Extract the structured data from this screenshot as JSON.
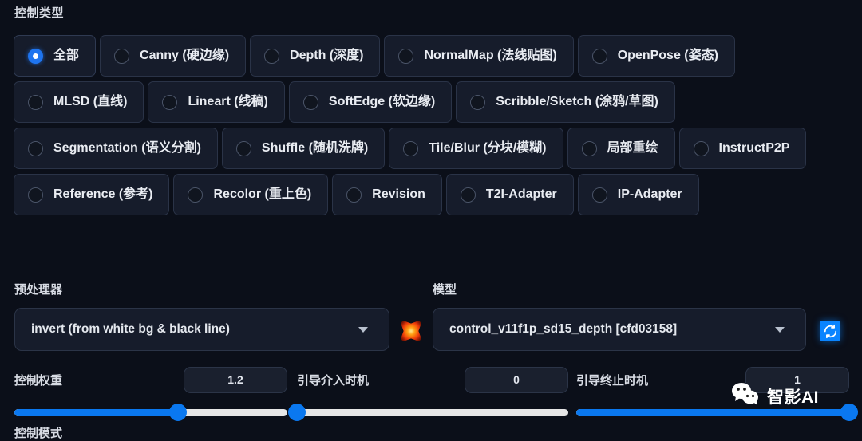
{
  "section": {
    "control_type_label": "控制类型"
  },
  "control_types": [
    {
      "label": "全部",
      "selected": true
    },
    {
      "label": "Canny (硬边缘)",
      "selected": false
    },
    {
      "label": "Depth (深度)",
      "selected": false
    },
    {
      "label": "NormalMap (法线贴图)",
      "selected": false
    },
    {
      "label": "OpenPose (姿态)",
      "selected": false
    },
    {
      "label": "MLSD (直线)",
      "selected": false
    },
    {
      "label": "Lineart (线稿)",
      "selected": false
    },
    {
      "label": "SoftEdge (软边缘)",
      "selected": false
    },
    {
      "label": "Scribble/Sketch (涂鸦/草图)",
      "selected": false
    },
    {
      "label": "Segmentation (语义分割)",
      "selected": false
    },
    {
      "label": "Shuffle (随机洗牌)",
      "selected": false
    },
    {
      "label": "Tile/Blur (分块/模糊)",
      "selected": false
    },
    {
      "label": "局部重绘",
      "selected": false
    },
    {
      "label": "InstructP2P",
      "selected": false
    },
    {
      "label": "Reference (参考)",
      "selected": false
    },
    {
      "label": "Recolor (重上色)",
      "selected": false
    },
    {
      "label": "Revision",
      "selected": false
    },
    {
      "label": "T2I-Adapter",
      "selected": false
    },
    {
      "label": "IP-Adapter",
      "selected": false
    }
  ],
  "preprocessor": {
    "label": "预处理器",
    "value": "invert (from white bg & black line)",
    "action_icon": "explosion-icon"
  },
  "model": {
    "label": "模型",
    "value": "control_v11f1p_sd15_depth [cfd03158]",
    "action_icon": "refresh-icon"
  },
  "sliders": [
    {
      "name": "控制权重",
      "value": "1.2",
      "percent": 60
    },
    {
      "name": "引导介入时机",
      "value": "0",
      "percent": 0
    },
    {
      "name": "引导终止时机",
      "value": "1",
      "percent": 100
    }
  ],
  "control_mode": {
    "label": "控制模式"
  },
  "watermark": {
    "icon": "wechat-icon",
    "text": "智影AI"
  },
  "colors": {
    "background": "#0b0f19",
    "card": "#161c2b",
    "border": "#2a3347",
    "accent": "#0a78f0",
    "track": "#e6e6e6"
  }
}
